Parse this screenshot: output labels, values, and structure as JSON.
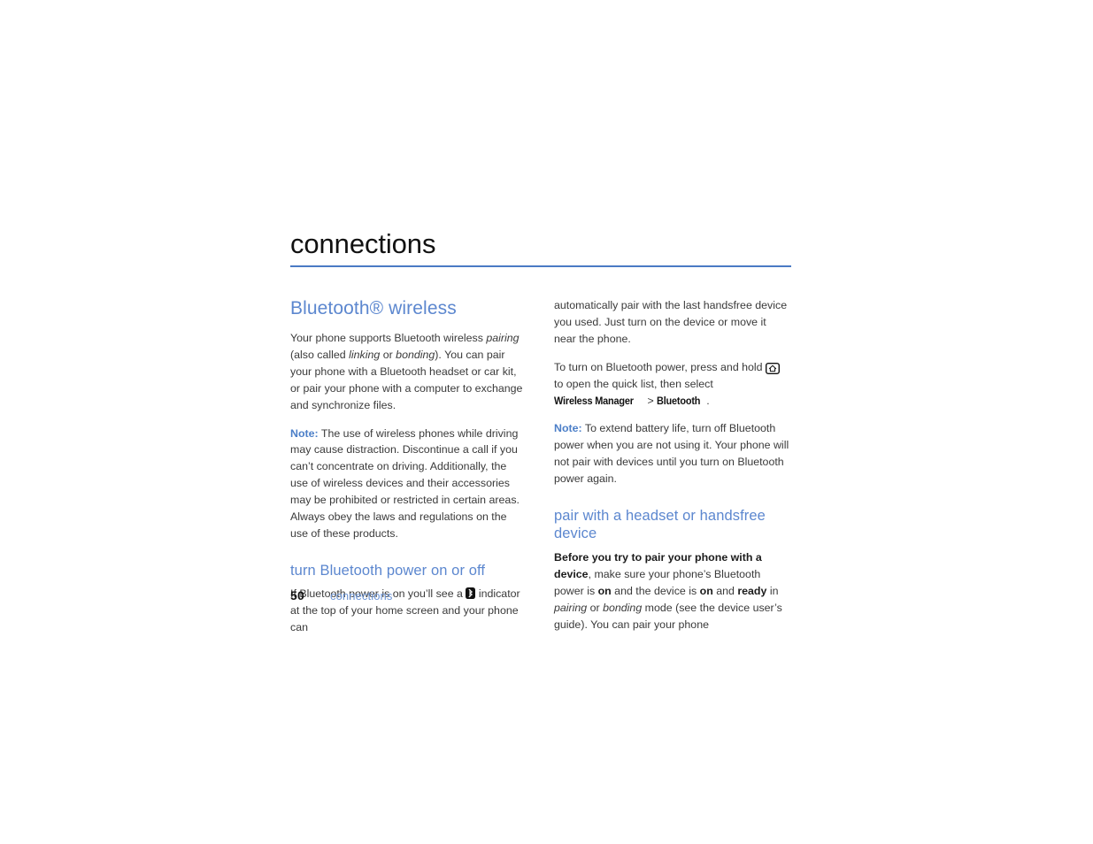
{
  "chapter": {
    "title": "connections",
    "rule_color": "#4a7ac4"
  },
  "colors": {
    "heading_blue": "#5c87cf",
    "note_blue": "#4c7fc8",
    "body_gray": "#3a3a3a",
    "folio_link_blue": "#6d95d6"
  },
  "left_column": {
    "section_heading": "Bluetooth® wireless",
    "p1": {
      "part1": "Your phone supports Bluetooth wireless ",
      "em1": "pairing",
      "part2": " (also called ",
      "em2": "linking",
      "part3": " or ",
      "em3": "bonding",
      "part4": "). You can pair your phone with a Bluetooth headset or car kit, or pair your phone with a computer to exchange and synchronize files."
    },
    "note1": {
      "label": "Note:",
      "text": " The use of wireless phones while driving may cause distraction. Discontinue a call if you can’t concentrate on driving. Additionally, the use of wireless devices and their accessories may be prohibited or restricted in certain areas. Always obey the laws and regulations on the use of these products."
    },
    "sub_heading": "turn Bluetooth power on or off",
    "p2": {
      "part1": "If Bluetooth power is on you’ll see a ",
      "icon": "bluetooth-indicator-icon",
      "part2": " indicator at the top of your home screen and your phone can"
    }
  },
  "right_column": {
    "p1": "automatically pair with the last handsfree device you used. Just turn on the device or move it near the phone.",
    "p2": {
      "part1": "To turn on Bluetooth power, press and hold ",
      "icon": "home-key-icon",
      "part2": " to open the quick list, then select ",
      "path1": "Wireless Manager",
      "separator": " > ",
      "path2": "Bluetooth",
      "part3": "."
    },
    "note1": {
      "label": "Note:",
      "text": " To extend battery life, turn off Bluetooth power when you are not using it. Your phone will not pair with devices until you turn on Bluetooth power again."
    },
    "sub_heading": "pair with a headset or handsfree device",
    "p3": {
      "strong1": "Before you try to pair your phone with a device",
      "part1": ", make sure your phone’s Bluetooth power is ",
      "strong2": "on",
      "part2": " and the device is ",
      "strong3": "on",
      "part3": " and ",
      "strong4": "ready",
      "part4": " in ",
      "em1": "pairing",
      "part5": " or ",
      "em2": "bonding",
      "part6": " mode (see the device user’s guide). You can pair your phone"
    }
  },
  "footer": {
    "page_number": "50",
    "chapter_label": "connections"
  }
}
